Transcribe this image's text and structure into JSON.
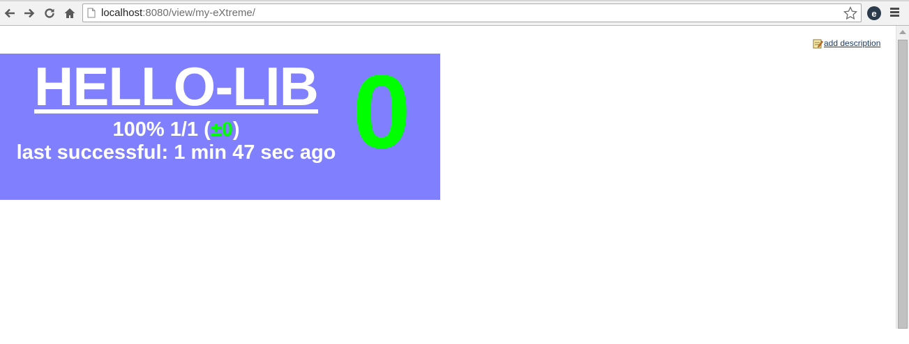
{
  "browser": {
    "url_host": "localhost",
    "url_rest": ":8080/view/my-eXtreme/",
    "extension_letter": "e",
    "icons": [
      "back-arrow-icon",
      "forward-arrow-icon",
      "reload-icon",
      "home-icon",
      "page-icon",
      "star-icon",
      "extension-icon",
      "menu-icon"
    ]
  },
  "page": {
    "add_description": "add description"
  },
  "job": {
    "name": "HELLO-LIB",
    "stats_prefix": "100% 1/1 (",
    "stats_delta": "±0",
    "stats_suffix": ")",
    "last_successful": "last successful: 1 min 47 sec ago",
    "count": "0",
    "colors": {
      "tile_background": "#8080ff",
      "text": "#ffffff",
      "accent": "#00ff00"
    }
  }
}
